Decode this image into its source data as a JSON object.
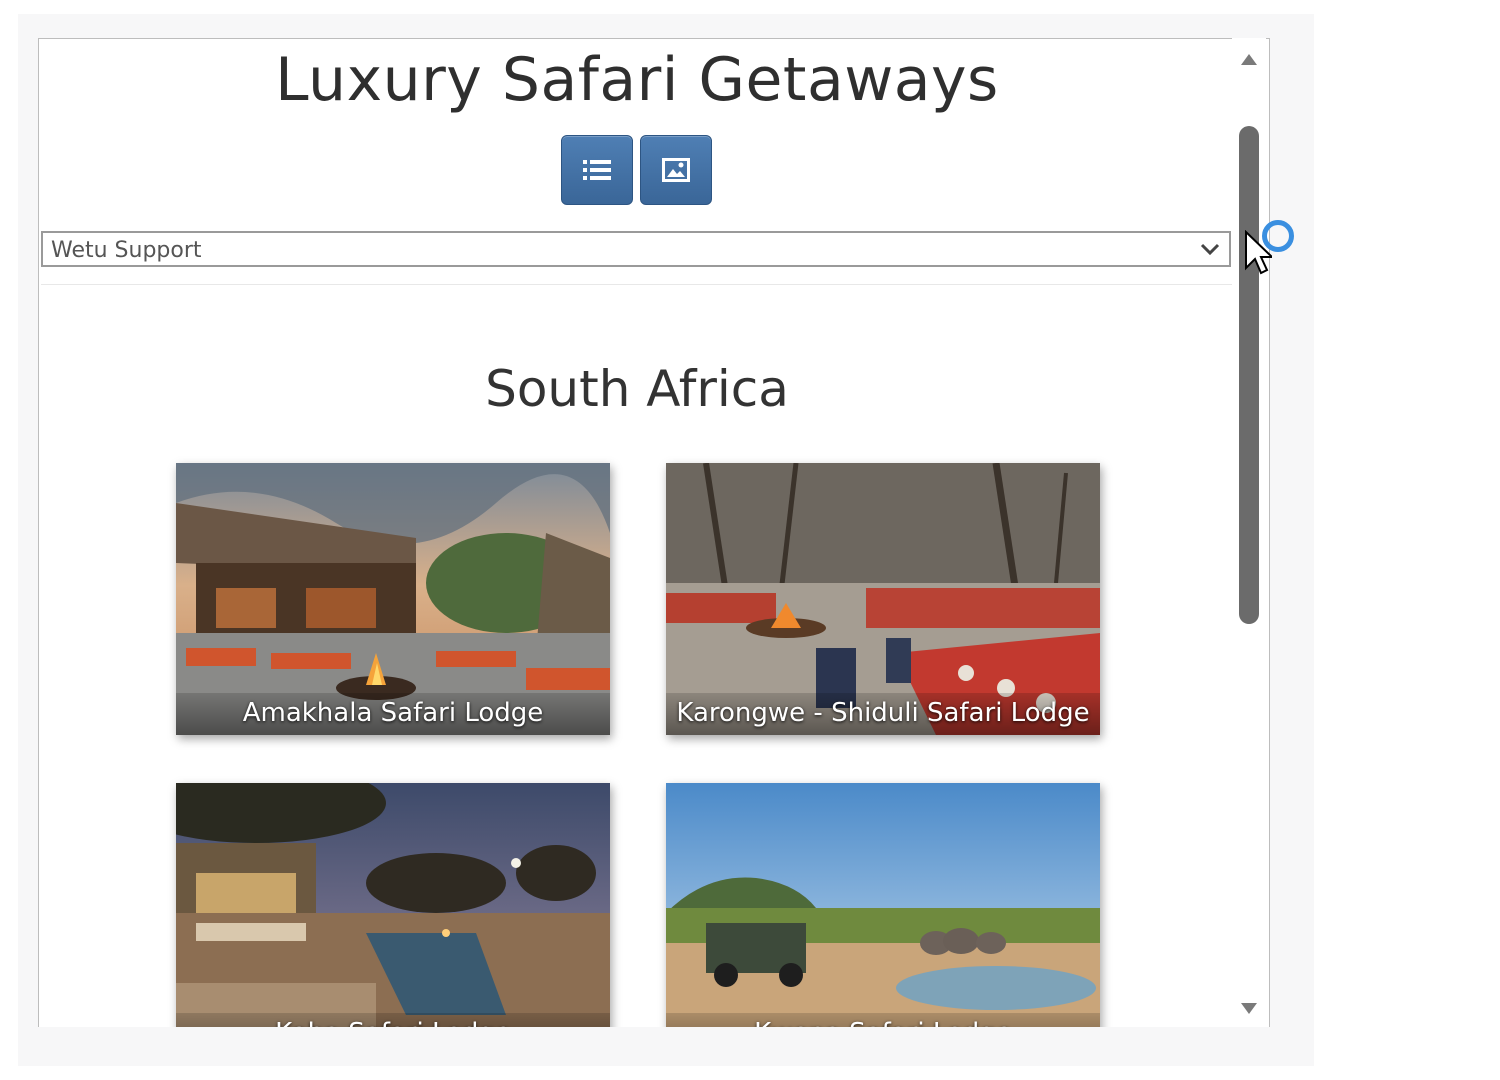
{
  "page": {
    "title": "Luxury Safari Getaways"
  },
  "toolbar": {
    "list_view_icon": "list-icon",
    "gallery_view_icon": "image-icon"
  },
  "select": {
    "value": "Wetu Support",
    "icon": "chevron-down-icon"
  },
  "region": {
    "title": "South Africa"
  },
  "cards": [
    {
      "name": "Amakhala Safari Lodge"
    },
    {
      "name": "Karongwe - Shiduli Safari Lodge"
    },
    {
      "name": "Kaba Safari Lodge"
    },
    {
      "name": "Kwena Safari Lodge"
    }
  ],
  "colors": {
    "button": "#3a6698",
    "scroll_thumb": "#6b6b6b",
    "click_ring": "#3a8fe0"
  }
}
